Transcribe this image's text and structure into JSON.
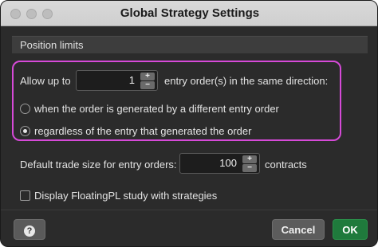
{
  "window": {
    "title": "Global Strategy Settings"
  },
  "section": {
    "title": "Position limits"
  },
  "limits": {
    "allow_up_to_label": "Allow up to",
    "entry_orders_value": "1",
    "entry_orders_suffix": "entry order(s) in the same direction:",
    "radio_options": [
      {
        "label": "when the order is generated by a different entry order",
        "selected": false
      },
      {
        "label": "regardless of the entry that generated the order",
        "selected": true
      }
    ]
  },
  "trade_size": {
    "label": "Default trade size for entry orders:",
    "value": "100",
    "unit": "contracts"
  },
  "floating_pl": {
    "label": "Display FloatingPL study with strategies",
    "checked": false
  },
  "footer": {
    "help_icon": "?",
    "cancel_label": "Cancel",
    "ok_label": "OK"
  },
  "colors": {
    "highlight": "#d64ad8",
    "ok_button": "#1f7a3c",
    "background": "#2b2b2b"
  },
  "icons": {
    "stepper_up": "plus-icon",
    "stepper_down": "minus-icon",
    "help": "question-icon"
  }
}
